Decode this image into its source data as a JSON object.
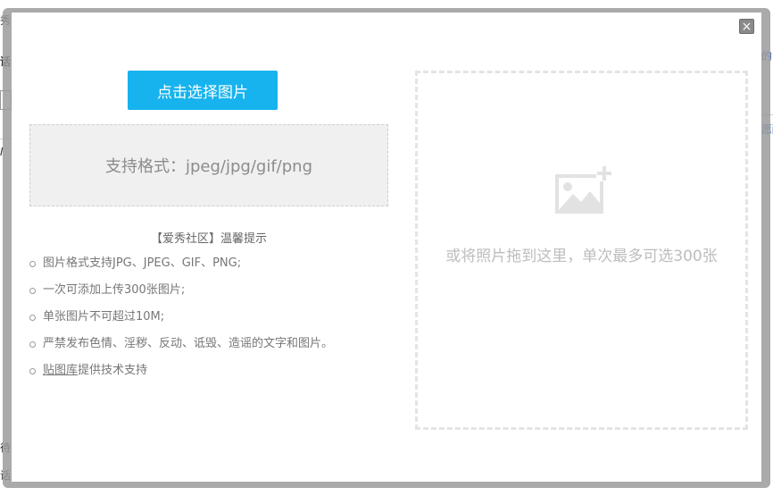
{
  "background_page": {
    "left_top": "秀",
    "left_mid": "话",
    "left_i": "I",
    "left_bottom1": "待图",
    "left_bottom2": "话题",
    "right_top": "的",
    "right_mid": "愿酬"
  },
  "modal": {
    "close_glyph": "×",
    "select_button_label": "点击选择图片",
    "formats_text": "支持格式：jpeg/jpg/gif/png",
    "tips_title": "【爱秀社区】温馨提示",
    "tips": [
      "图片格式支持JPG、JPEG、GIF、PNG;",
      "一次可添加上传300张图片;",
      "单张图片不可超过10M;",
      "严禁发布色情、淫秽、反动、诋毁、造谣的文字和图片。"
    ],
    "provider_link": "贴图库",
    "provider_suffix": "提供技术支持",
    "drop_text": "或将照片拖到这里，单次最多可选300张",
    "drop_icon": "add-image-icon"
  },
  "colors": {
    "primary_button": "#17b3ee",
    "drop_border": "#e4e4e4",
    "format_box_bg": "#f0f0f0"
  }
}
